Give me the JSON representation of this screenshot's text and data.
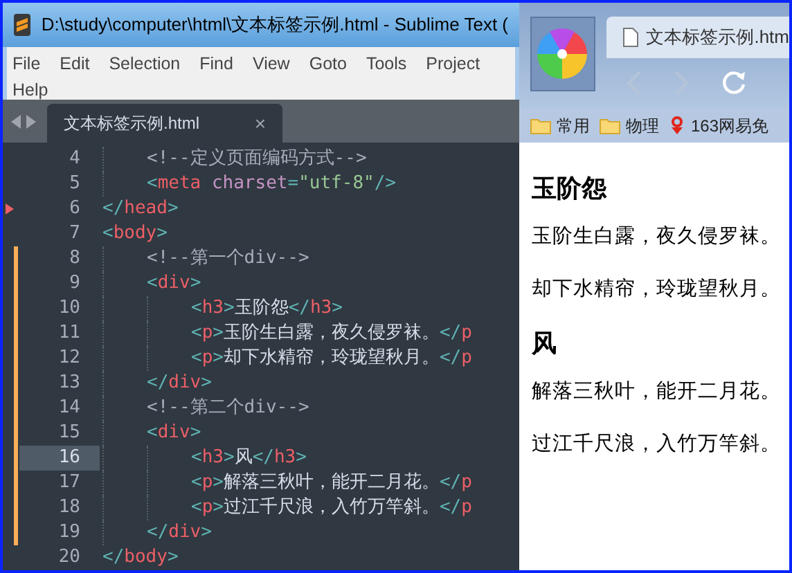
{
  "editor": {
    "title": "D:\\study\\computer\\html\\文本标签示例.html - Sublime Text (",
    "menu": [
      "File",
      "Edit",
      "Selection",
      "Find",
      "View",
      "Goto",
      "Tools",
      "Project",
      "Help"
    ],
    "tabs": [
      {
        "label": "文本标签示例.html",
        "selected": true,
        "close": "×"
      }
    ],
    "lines": [
      {
        "children": [
          {
            "number": "4",
            "current": false,
            "modified": false,
            "bookmark": false,
            "tokens": [
              {
                "kind": "comment",
                "text": "<!--定义页面编码方式-->"
              }
            ]
          },
          {
            "number": "5",
            "current": false,
            "modified": false,
            "bookmark": false,
            "tokens": [
              {
                "kind": "punct",
                "text": "<"
              },
              {
                "kind": "tag",
                "text": "meta"
              },
              {
                "kind": "attr",
                "text": "charset"
              },
              {
                "kind": "punct",
                "text": "="
              },
              {
                "kind": "string",
                "text": "\"utf-8\""
              },
              {
                "kind": "punct",
                "text": "/>"
              }
            ]
          }
        ]
      },
      {
        "number": "6",
        "current": false,
        "modified": false,
        "bookmark": true,
        "tokens": [
          {
            "kind": "punct",
            "text": "</"
          },
          {
            "kind": "tag",
            "text": "head"
          },
          {
            "kind": "punct",
            "text": ">"
          }
        ]
      },
      {
        "number": "7",
        "current": false,
        "modified": false,
        "bookmark": false,
        "tokens": [
          {
            "kind": "punct",
            "text": "<"
          },
          {
            "kind": "tag",
            "text": "body"
          },
          {
            "kind": "punct",
            "text": ">"
          }
        ],
        "children": [
          {
            "number": "8",
            "current": false,
            "modified": true,
            "bookmark": false,
            "tokens": [
              {
                "kind": "comment",
                "text": "<!--第一个div-->"
              }
            ]
          },
          {
            "number": "9",
            "current": false,
            "modified": true,
            "bookmark": false,
            "tokens": [
              {
                "kind": "punct",
                "text": "<"
              },
              {
                "kind": "tag",
                "text": "div"
              },
              {
                "kind": "punct",
                "text": ">"
              }
            ],
            "children": [
              {
                "number": "10",
                "current": false,
                "modified": true,
                "bookmark": false,
                "tokens": [
                  {
                    "kind": "punct",
                    "text": "<"
                  },
                  {
                    "kind": "tag",
                    "text": "h3"
                  },
                  {
                    "kind": "punct",
                    "text": ">"
                  },
                  {
                    "kind": "plain",
                    "text": "玉阶怨"
                  },
                  {
                    "kind": "punct",
                    "text": "</"
                  },
                  {
                    "kind": "tag",
                    "text": "h3"
                  },
                  {
                    "kind": "punct",
                    "text": ">"
                  }
                ]
              },
              {
                "number": "11",
                "current": false,
                "modified": true,
                "bookmark": false,
                "tokens": [
                  {
                    "kind": "punct",
                    "text": "<"
                  },
                  {
                    "kind": "tag",
                    "text": "p"
                  },
                  {
                    "kind": "punct",
                    "text": ">"
                  },
                  {
                    "kind": "plain",
                    "text": "玉阶生白露，夜久侵罗袜。"
                  },
                  {
                    "kind": "punct",
                    "text": "</"
                  },
                  {
                    "kind": "tag",
                    "text": "p"
                  }
                ]
              },
              {
                "number": "12",
                "current": false,
                "modified": true,
                "bookmark": false,
                "tokens": [
                  {
                    "kind": "punct",
                    "text": "<"
                  },
                  {
                    "kind": "tag",
                    "text": "p"
                  },
                  {
                    "kind": "punct",
                    "text": ">"
                  },
                  {
                    "kind": "plain",
                    "text": "却下水精帘，玲珑望秋月。"
                  },
                  {
                    "kind": "punct",
                    "text": "</"
                  },
                  {
                    "kind": "tag",
                    "text": "p"
                  }
                ]
              }
            ]
          },
          {
            "number": "13",
            "current": false,
            "modified": true,
            "bookmark": false,
            "tokens": [
              {
                "kind": "punct",
                "text": "</"
              },
              {
                "kind": "tag",
                "text": "div"
              },
              {
                "kind": "punct",
                "text": ">"
              }
            ]
          },
          {
            "number": "14",
            "current": false,
            "modified": true,
            "bookmark": false,
            "tokens": [
              {
                "kind": "comment",
                "text": "<!--第二个div-->"
              }
            ]
          },
          {
            "number": "15",
            "current": false,
            "modified": true,
            "bookmark": false,
            "tokens": [
              {
                "kind": "punct",
                "text": "<"
              },
              {
                "kind": "tag",
                "text": "div"
              },
              {
                "kind": "punct",
                "text": ">"
              }
            ],
            "children": [
              {
                "number": "16",
                "current": true,
                "modified": true,
                "bookmark": false,
                "tokens": [
                  {
                    "kind": "punct",
                    "text": "<"
                  },
                  {
                    "kind": "tag",
                    "text": "h3"
                  },
                  {
                    "kind": "punct",
                    "text": ">"
                  },
                  {
                    "kind": "plain",
                    "text": "风"
                  },
                  {
                    "kind": "punct",
                    "text": "</"
                  },
                  {
                    "kind": "tag",
                    "text": "h3"
                  },
                  {
                    "kind": "punct",
                    "text": ">"
                  }
                ]
              },
              {
                "number": "17",
                "current": false,
                "modified": true,
                "bookmark": false,
                "tokens": [
                  {
                    "kind": "punct",
                    "text": "<"
                  },
                  {
                    "kind": "tag",
                    "text": "p"
                  },
                  {
                    "kind": "punct",
                    "text": ">"
                  },
                  {
                    "kind": "plain",
                    "text": "解落三秋叶，能开二月花。"
                  },
                  {
                    "kind": "punct",
                    "text": "</"
                  },
                  {
                    "kind": "tag",
                    "text": "p"
                  }
                ]
              },
              {
                "number": "18",
                "current": false,
                "modified": true,
                "bookmark": false,
                "tokens": [
                  {
                    "kind": "punct",
                    "text": "<"
                  },
                  {
                    "kind": "tag",
                    "text": "p"
                  },
                  {
                    "kind": "punct",
                    "text": ">"
                  },
                  {
                    "kind": "plain",
                    "text": "过江千尺浪，入竹万竿斜。"
                  },
                  {
                    "kind": "punct",
                    "text": "</"
                  },
                  {
                    "kind": "tag",
                    "text": "p"
                  }
                ]
              }
            ]
          },
          {
            "number": "19",
            "current": false,
            "modified": true,
            "bookmark": false,
            "tokens": [
              {
                "kind": "punct",
                "text": "</"
              },
              {
                "kind": "tag",
                "text": "div"
              },
              {
                "kind": "punct",
                "text": ">"
              }
            ]
          }
        ]
      },
      {
        "number": "20",
        "current": false,
        "modified": false,
        "bookmark": false,
        "tokens": [
          {
            "kind": "punct",
            "text": "</"
          },
          {
            "kind": "tag",
            "text": "body"
          },
          {
            "kind": "punct",
            "text": ">"
          }
        ]
      }
    ]
  },
  "browser": {
    "tab": {
      "label": "文本标签示例.htm",
      "selected": true
    },
    "bookmarks": [
      {
        "kind": "folder",
        "label": "常用"
      },
      {
        "kind": "folder",
        "label": "物理"
      },
      {
        "kind": "site",
        "label": "163网易免"
      }
    ],
    "content": [
      {
        "kind": "heading",
        "text": "玉阶怨"
      },
      {
        "kind": "paragraph",
        "text": "玉阶生白露，夜久侵罗袜。"
      },
      {
        "kind": "paragraph",
        "text": "却下水精帘，玲珑望秋月。"
      },
      {
        "kind": "heading",
        "text": "风"
      },
      {
        "kind": "paragraph",
        "text": "解落三秋叶，能开二月花。"
      },
      {
        "kind": "paragraph",
        "text": "过江千尺浪，入竹万竿斜。"
      }
    ]
  }
}
